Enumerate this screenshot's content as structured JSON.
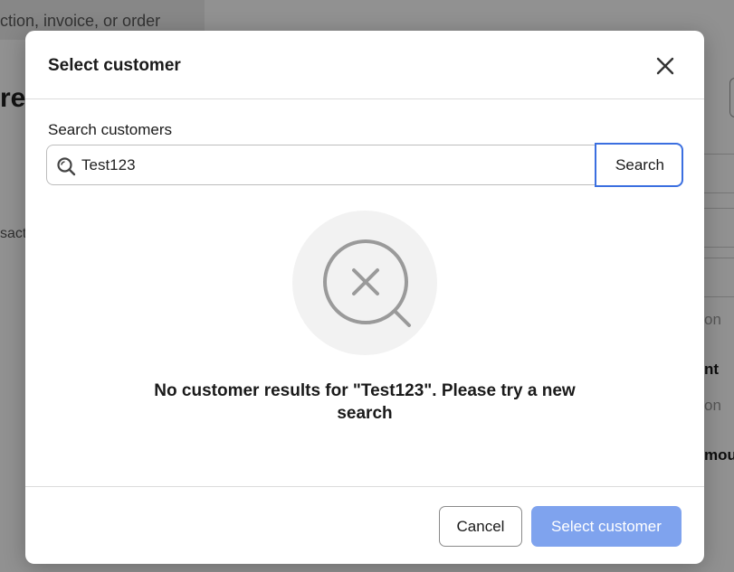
{
  "background": {
    "search_placeholder": "ction, invoice, or order",
    "heading_fragment": "re",
    "text_fragment": "sact",
    "right_fragments": [
      "on",
      "nt",
      "on",
      "mou"
    ]
  },
  "modal": {
    "title": "Select customer",
    "close_icon": "close-icon",
    "search": {
      "label": "Search customers",
      "value": "Test123",
      "button_label": "Search",
      "icon": "search-icon"
    },
    "empty_state": {
      "icon": "search-no-results-icon",
      "message": "No customer results for \"Test123\". Please try a new search"
    },
    "footer": {
      "cancel_label": "Cancel",
      "select_label": "Select customer",
      "select_disabled": true
    }
  },
  "colors": {
    "accent": "#3b6fe0",
    "primary_disabled": "#7fa3ee",
    "overlay": "rgba(0,0,0,0.43)"
  }
}
